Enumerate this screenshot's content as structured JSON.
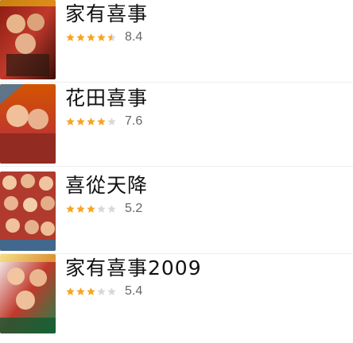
{
  "colors": {
    "star_filled": "#f5a623",
    "star_empty": "#d8d8d8",
    "title": "#111111",
    "score": "#666666"
  },
  "items": [
    {
      "title": "家有喜事",
      "score": "8.4",
      "stars": 4.5,
      "poster_icon": "movie-poster"
    },
    {
      "title": "花田喜事",
      "score": "7.6",
      "stars": 4.0,
      "poster_icon": "movie-poster"
    },
    {
      "title": "喜從天降",
      "score": "5.2",
      "stars": 3.0,
      "poster_icon": "movie-poster"
    },
    {
      "title": "家有喜事2009",
      "score": "5.4",
      "stars": 3.0,
      "poster_icon": "movie-poster"
    }
  ]
}
